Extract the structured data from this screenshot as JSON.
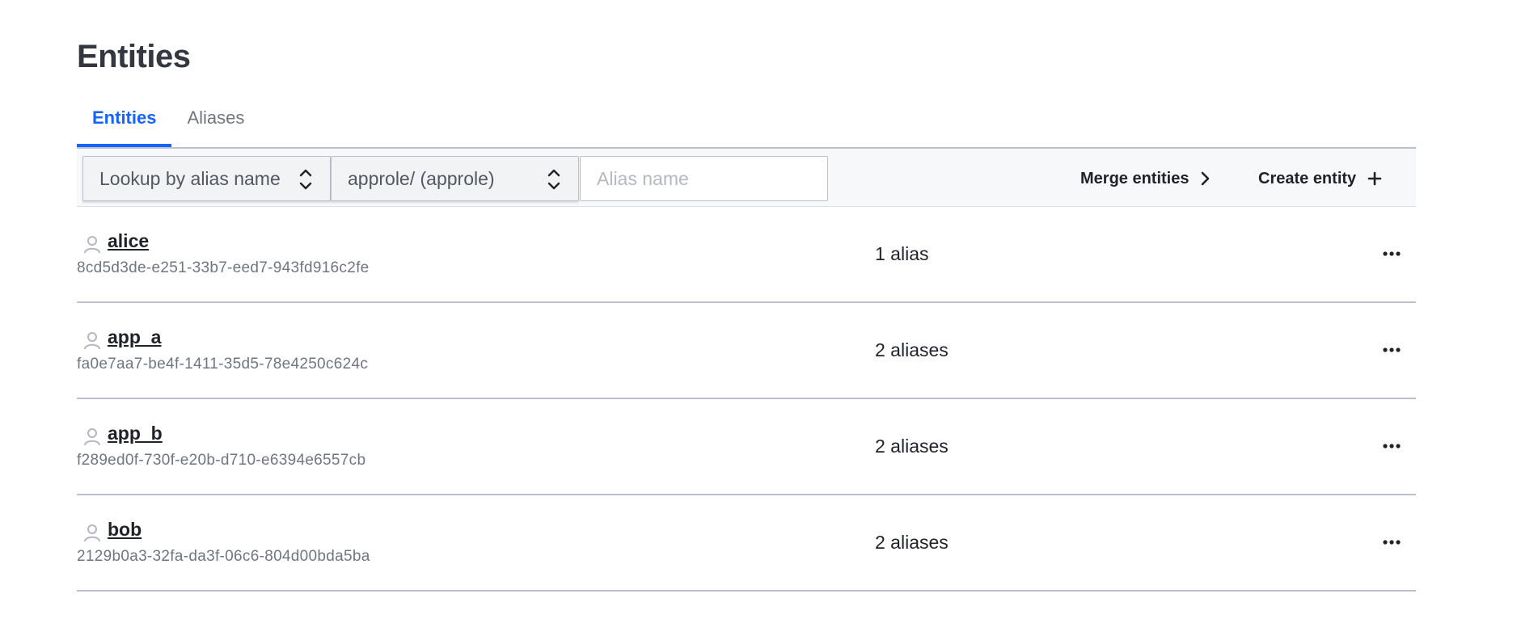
{
  "page": {
    "title": "Entities"
  },
  "tabs": [
    {
      "label": "Entities",
      "active": true
    },
    {
      "label": "Aliases",
      "active": false
    }
  ],
  "toolbar": {
    "lookup_select": "Lookup by alias name",
    "mount_select": "approle/ (approle)",
    "alias_input_placeholder": "Alias name",
    "alias_input_value": "",
    "merge_label": "Merge entities",
    "create_label": "Create entity"
  },
  "entities": [
    {
      "name": "alice",
      "id": "8cd5d3de-e251-33b7-eed7-943fd916c2fe",
      "alias_count": "1 alias"
    },
    {
      "name": "app_a",
      "id": "fa0e7aa7-be4f-1411-35d5-78e4250c624c",
      "alias_count": "2 aliases"
    },
    {
      "name": "app_b",
      "id": "f289ed0f-730f-e20b-d710-e6394e6557cb",
      "alias_count": "2 aliases"
    },
    {
      "name": "bob",
      "id": "2129b0a3-32fa-da3f-06c6-804d00bda5ba",
      "alias_count": "2 aliases"
    }
  ],
  "icons": {
    "user": "user-icon",
    "more": "more-options-icon",
    "select": "select-chevrons-icon",
    "merge": "chevron-right-icon",
    "create": "plus-icon"
  },
  "colors": {
    "accent": "#1563ff",
    "text": "#1f2329",
    "muted": "#6f7682",
    "border": "#bac1cc"
  }
}
